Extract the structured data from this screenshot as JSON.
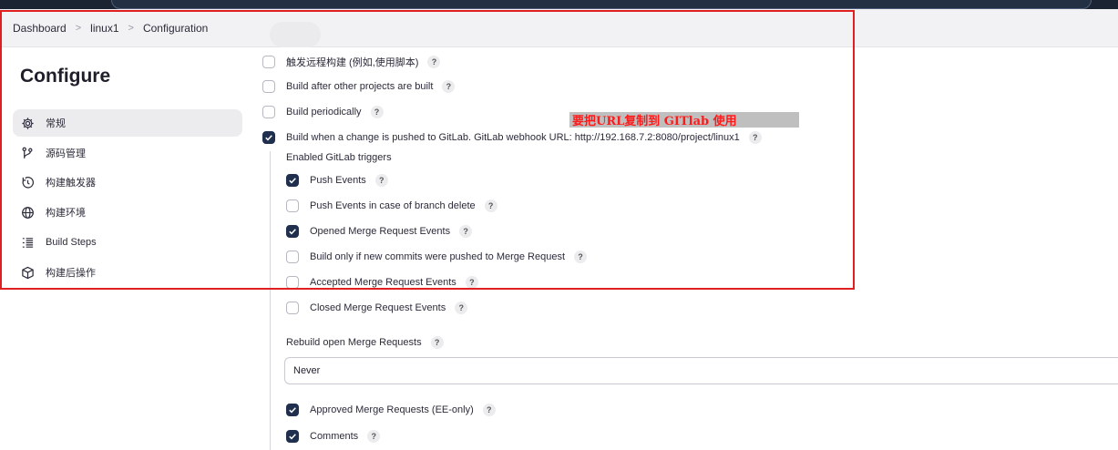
{
  "breadcrumb": {
    "items": [
      "Dashboard",
      "linux1",
      "Configuration"
    ],
    "separator": ">"
  },
  "sidebar": {
    "title": "Configure",
    "items": [
      {
        "label": "常规",
        "icon": "gear-icon",
        "active": true
      },
      {
        "label": "源码管理",
        "icon": "source-branch-icon",
        "active": false
      },
      {
        "label": "构建触发器",
        "icon": "clock-trigger-icon",
        "active": false
      },
      {
        "label": "构建环境",
        "icon": "globe-icon",
        "active": false
      },
      {
        "label": "Build Steps",
        "icon": "list-steps-icon",
        "active": false
      },
      {
        "label": "构建后操作",
        "icon": "package-icon",
        "active": false
      }
    ]
  },
  "triggers": {
    "remote": {
      "label": "触发远程构建 (例如,使用脚本)",
      "checked": false
    },
    "after_other": {
      "label": "Build after other projects are built",
      "checked": false
    },
    "periodic": {
      "label": "Build periodically",
      "checked": false
    },
    "gitlab_push": {
      "label": "Build when a change is pushed to GitLab. GitLab webhook URL: http://192.168.7.2:8080/project/linux1",
      "checked": true
    }
  },
  "gitlab": {
    "enabled_label": "Enabled GitLab triggers",
    "options": [
      {
        "label": "Push Events",
        "checked": true
      },
      {
        "label": "Push Events in case of branch delete",
        "checked": false
      },
      {
        "label": "Opened Merge Request Events",
        "checked": true
      },
      {
        "label": "Build only if new commits were pushed to Merge Request",
        "checked": false
      },
      {
        "label": "Accepted Merge Request Events",
        "checked": false
      },
      {
        "label": "Closed Merge Request Events",
        "checked": false
      }
    ],
    "rebuild_label": "Rebuild open Merge Requests",
    "rebuild_value": "Never",
    "approved": {
      "label": "Approved Merge Requests (EE-only)",
      "checked": true
    },
    "comments": {
      "label": "Comments",
      "checked": true
    }
  },
  "help_glyph": "?",
  "annotation": {
    "text": "要把URL复制到 GITlab 使用",
    "text_color": "#ff1a1a",
    "background": "#bfbfbf"
  },
  "colors": {
    "checkbox_checked": "#1f2f4d",
    "highlight_box": "#e02020"
  }
}
